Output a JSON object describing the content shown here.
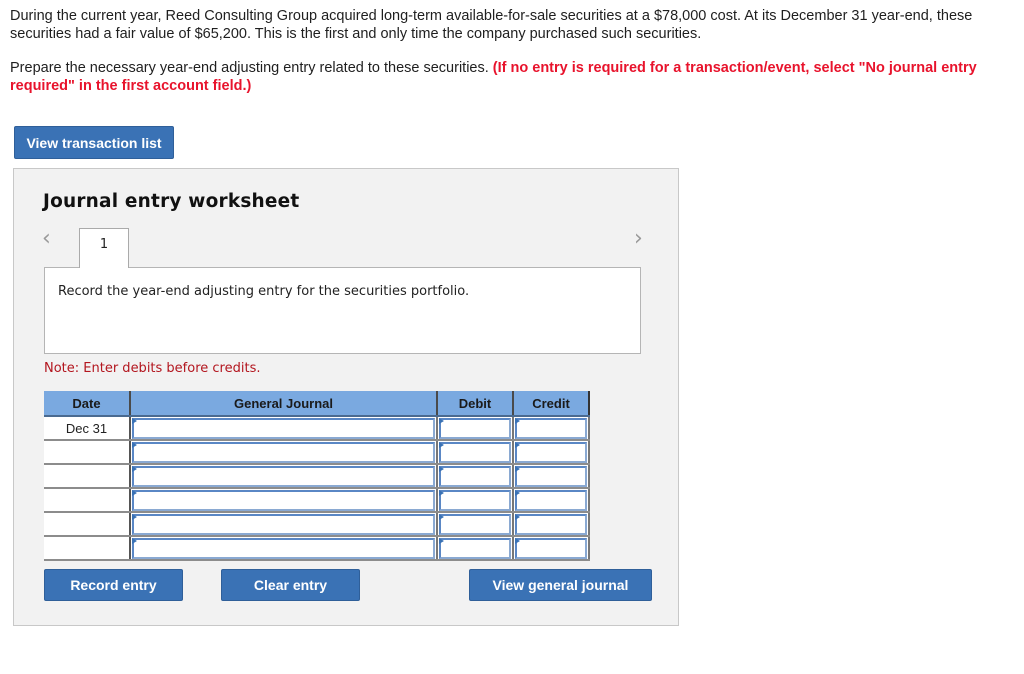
{
  "problem": {
    "paragraph1": "During the current year, Reed Consulting Group acquired long-term available-for-sale securities at a $78,000 cost. At its December 31 year-end, these securities had a fair value of $65,200. This is the first and only time the company purchased such securities.",
    "paragraph2_plain": "Prepare the necessary year-end adjusting entry related to these securities. ",
    "paragraph2_emphasis": "(If no entry is required for a transaction/event, select \"No journal entry required\" in the first account field.)"
  },
  "buttons": {
    "view_transaction_list": "View transaction list",
    "record_entry": "Record entry",
    "clear_entry": "Clear entry",
    "view_general_journal": "View general journal"
  },
  "worksheet": {
    "title": "Journal entry worksheet",
    "prev_icon": "‹",
    "next_icon": "›",
    "tabs": [
      {
        "label": "1",
        "active": true
      }
    ],
    "instruction": "Record the year-end adjusting entry for the securities portfolio.",
    "note": "Note: Enter debits before credits."
  },
  "journal_table": {
    "headers": {
      "date": "Date",
      "general_journal": "General Journal",
      "debit": "Debit",
      "credit": "Credit"
    },
    "rows": [
      {
        "date": "Dec 31",
        "account": "",
        "debit": "",
        "credit": ""
      },
      {
        "date": "",
        "account": "",
        "debit": "",
        "credit": ""
      },
      {
        "date": "",
        "account": "",
        "debit": "",
        "credit": ""
      },
      {
        "date": "",
        "account": "",
        "debit": "",
        "credit": ""
      },
      {
        "date": "",
        "account": "",
        "debit": "",
        "credit": ""
      },
      {
        "date": "",
        "account": "",
        "debit": "",
        "credit": ""
      }
    ]
  },
  "colors": {
    "button_blue": "#3a72b5",
    "header_blue": "#7aa9e0",
    "emphasis_red": "#e8132c",
    "note_red": "#b3161f"
  }
}
